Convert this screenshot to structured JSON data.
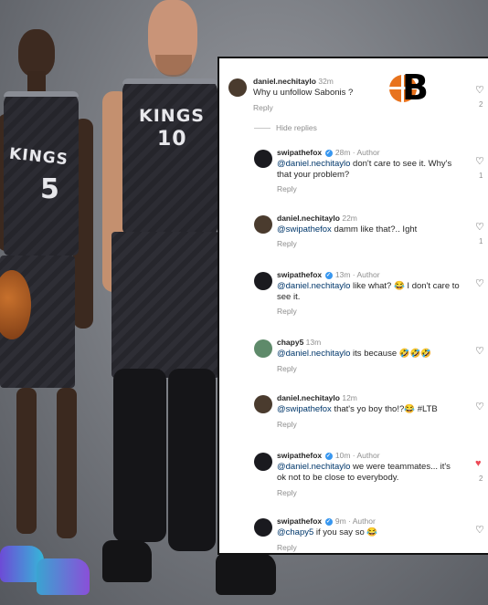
{
  "background": {
    "alt": "two basketball players in Kings jerseys"
  },
  "players": [
    {
      "jersey_text": "KINGS",
      "number": "5"
    },
    {
      "jersey_text": "KINGS",
      "number": "10"
    }
  ],
  "logo": {
    "letter": "B"
  },
  "post": {
    "top_comment": {
      "user": "daniel.nechitaylo",
      "time": "32m",
      "text": "Why u unfollow Sabonis ?",
      "reply": "Reply",
      "likes": "2"
    },
    "hide_replies": "Hide replies",
    "replies": [
      {
        "user": "swipathefox",
        "meta": "28m · Author",
        "mention": "@daniel.nechitaylo",
        "text": " don't care to see it. Why's that your problem?",
        "reply": "Reply",
        "likes": "1"
      },
      {
        "user": "daniel.nechitaylo",
        "meta": "22m",
        "mention": "@swipathefox",
        "text": " damm like that?.. Ight",
        "reply": "Reply",
        "likes": "1"
      },
      {
        "user": "swipathefox",
        "meta": "13m · Author",
        "mention": "@daniel.nechitaylo",
        "text": " like what? 😂 I don't care to see it.",
        "reply": "Reply",
        "likes": ""
      },
      {
        "user": "chapy5",
        "meta": "13m",
        "mention": "@daniel.nechitaylo",
        "text": " its because 🤣🤣🤣",
        "reply": "Reply",
        "likes": ""
      },
      {
        "user": "daniel.nechitaylo",
        "meta": "12m",
        "mention": "@swipathefox",
        "text": " that's yo boy tho!?😂 #LTB",
        "reply": "Reply",
        "likes": ""
      },
      {
        "user": "swipathefox",
        "meta": "10m · Author",
        "mention": "@daniel.nechitaylo",
        "text": " we were teammates... it's ok not to be close to everybody.",
        "reply": "Reply",
        "likes": "2"
      },
      {
        "user": "swipathefox",
        "meta": "9m · Author",
        "mention": "@chapy5",
        "text": " if you say so 😂",
        "reply": "Reply",
        "likes": ""
      }
    ]
  },
  "colors": {
    "accent": "#ed4956",
    "link": "#00376b",
    "verified": "#3897f0",
    "logo_orange": "#e8731e"
  }
}
